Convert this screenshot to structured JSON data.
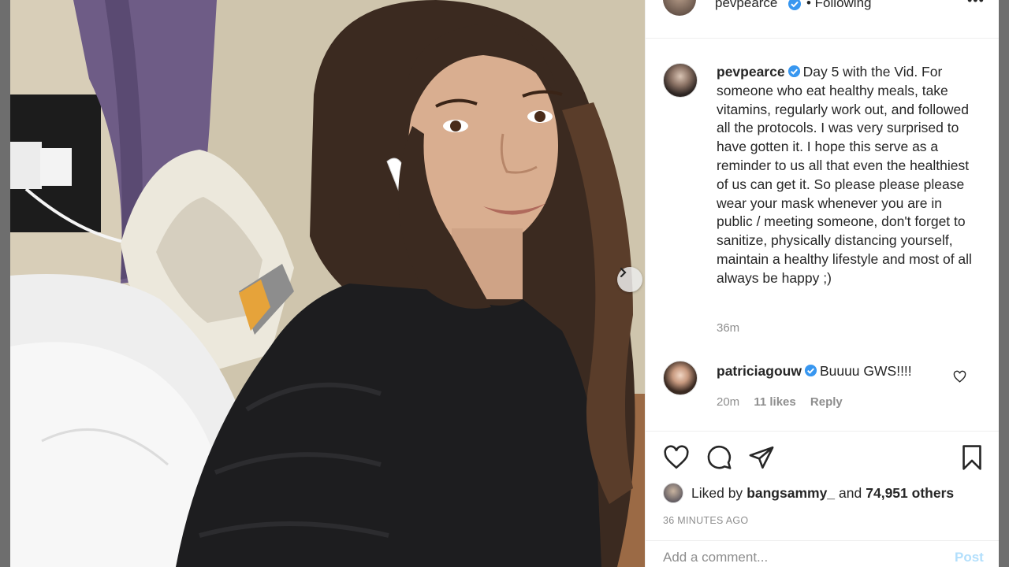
{
  "header": {
    "username": "pevpearce",
    "following_label": "• Following",
    "more_label": "•••"
  },
  "caption": {
    "username": "pevpearce",
    "text": "Day 5 with the Vid. For someone who eat healthy meals, take vitamins, regularly work out, and followed all the protocols. I was very surprised to have gotten it. I hope this serve as a reminder to us all that even the healthiest of us can get it. So please please please wear your mask whenever you are in public / meeting someone, don't forget to sanitize, physically distancing yourself, maintain a healthy lifestyle and most of all always be happy ;)",
    "time": "36m"
  },
  "comment": {
    "username": "patriciagouw",
    "text": "Buuuu GWS!!!!",
    "time": "20m",
    "likes": "11 likes",
    "reply_label": "Reply"
  },
  "likes": {
    "prefix": "Liked by",
    "user": "bangsammy_",
    "conj": "and",
    "others": "74,951 others"
  },
  "posted_ago": "36 MINUTES AGO",
  "add_comment": {
    "placeholder": "Add a comment...",
    "post_label": "Post"
  },
  "colors": {
    "verified": "#3897f0",
    "muted": "#8e8e8e",
    "text": "#262626"
  }
}
